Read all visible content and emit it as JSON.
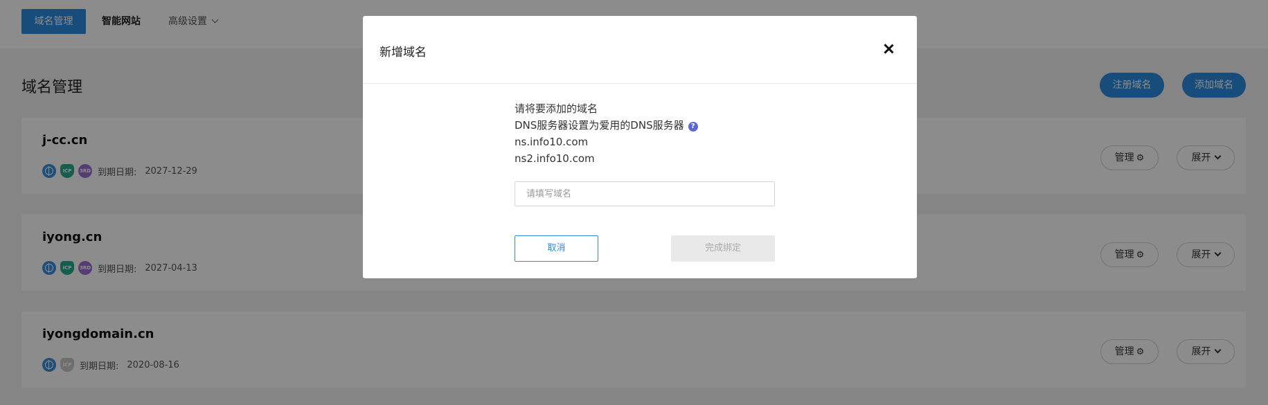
{
  "nav": {
    "items": [
      {
        "label": "域名管理"
      },
      {
        "label": "智能网站"
      },
      {
        "label": "高级设置"
      }
    ]
  },
  "page": {
    "title": "域名管理",
    "register_label": "注册域名",
    "add_label": "添加域名"
  },
  "domains": [
    {
      "name": "j-cc.cn",
      "expiry_label": "到期日期:",
      "expiry_date": "2027-12-29",
      "icp_active": true,
      "has_3rd": true,
      "manage_label": "管理",
      "expand_label": "展开"
    },
    {
      "name": "iyong.cn",
      "expiry_label": "到期日期:",
      "expiry_date": "2027-04-13",
      "icp_active": true,
      "has_3rd": true,
      "manage_label": "管理",
      "expand_label": "展开"
    },
    {
      "name": "iyongdomain.cn",
      "expiry_label": "到期日期:",
      "expiry_date": "2020-08-16",
      "icp_active": false,
      "has_3rd": false,
      "manage_label": "管理",
      "expand_label": "展开"
    }
  ],
  "icons": {
    "globe": "globe-icon",
    "icp": "icp-badge-icon",
    "third": "3rd-badge-icon",
    "icp_text": "ICP",
    "third_text": "3RD",
    "gear": "gear-icon",
    "chevron": "chevron-down-icon",
    "help": "help-icon",
    "close": "close-icon"
  },
  "modal": {
    "title": "新增域名",
    "line1": "请将要添加的域名",
    "line2": "DNS服务器设置为爱用的DNS服务器",
    "ns1": "ns.info10.com",
    "ns2": "ns2.info10.com",
    "input_placeholder": "请填写域名",
    "input_value": "",
    "cancel_label": "取消",
    "finish_label": "完成绑定"
  },
  "colors": {
    "accent": "#2d8ce0",
    "overlay": "rgba(0,0,0,0.45)",
    "icp_active": "#1fae8a",
    "badge_3rd": "#9b6fd1",
    "help": "#5a68d6"
  }
}
